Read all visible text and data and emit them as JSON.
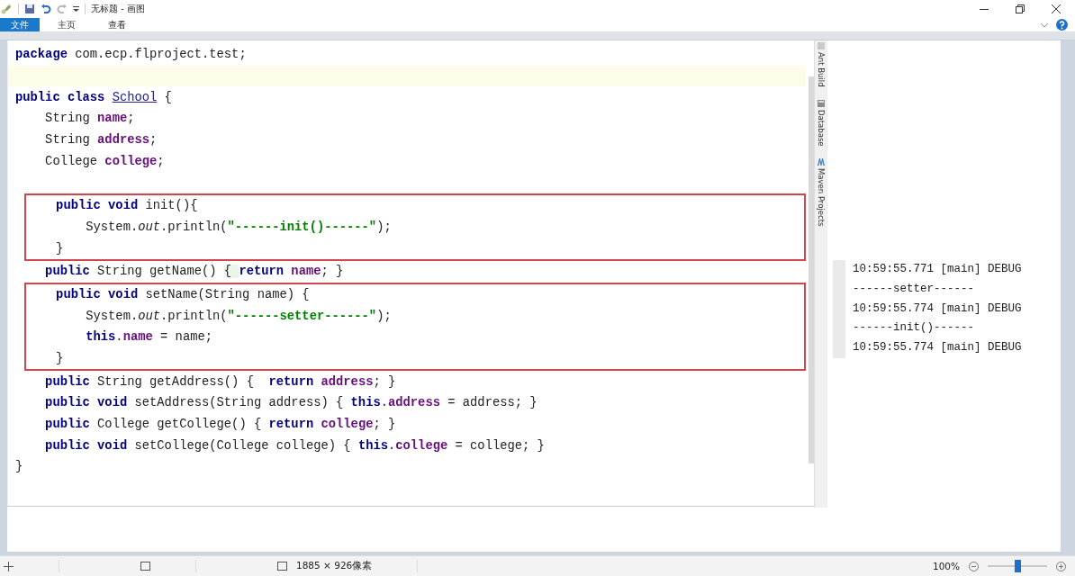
{
  "window": {
    "title": "无标题 - 画图"
  },
  "ribbon_tabs": [
    {
      "label": "文件",
      "selected": true
    },
    {
      "label": "主页",
      "selected": false
    },
    {
      "label": "查看",
      "selected": false
    }
  ],
  "code_blocks": [
    {
      "highlighted": false,
      "lines": [
        {
          "current": false,
          "tokens": [
            {
              "kind": "kw",
              "text": "package"
            },
            {
              "kind": "plain",
              "text": " com.ecp.flproject.test;"
            }
          ]
        },
        {
          "current": true
        },
        {
          "current": false,
          "tokens": [
            {
              "kind": "kw",
              "text": "public class "
            },
            {
              "kind": "link",
              "text": "School"
            },
            {
              "kind": "plain",
              "text": " {"
            }
          ]
        },
        {
          "current": false,
          "tokens": [
            {
              "kind": "plain",
              "text": "    String "
            },
            {
              "kind": "field",
              "text": "name"
            },
            {
              "kind": "plain",
              "text": ";"
            }
          ]
        },
        {
          "current": false,
          "tokens": [
            {
              "kind": "plain",
              "text": "    String "
            },
            {
              "kind": "field",
              "text": "address"
            },
            {
              "kind": "plain",
              "text": ";"
            }
          ]
        },
        {
          "current": false,
          "tokens": [
            {
              "kind": "plain",
              "text": "    College "
            },
            {
              "kind": "field",
              "text": "college"
            },
            {
              "kind": "plain",
              "text": ";"
            }
          ]
        },
        {
          "current": false
        }
      ]
    },
    {
      "highlighted": true,
      "lines": [
        {
          "current": false,
          "tokens": [
            {
              "kind": "kw",
              "text": "    public void"
            },
            {
              "kind": "plain",
              "text": " init(){"
            }
          ]
        },
        {
          "current": false,
          "tokens": [
            {
              "kind": "plain",
              "text": "        System."
            },
            {
              "kind": "italic",
              "text": "out"
            },
            {
              "kind": "plain",
              "text": ".println("
            },
            {
              "kind": "str",
              "text": "\"------init()------\""
            },
            {
              "kind": "plain",
              "text": ");"
            }
          ]
        },
        {
          "current": false,
          "tokens": [
            {
              "kind": "plain",
              "text": "    }"
            }
          ]
        }
      ]
    },
    {
      "highlighted": false,
      "lines": [
        {
          "current": false,
          "tokens": [
            {
              "kind": "kw",
              "text": "    public"
            },
            {
              "kind": "plain",
              "text": " String getName() "
            },
            {
              "kind": "fold",
              "text": "{ "
            },
            {
              "kind": "kw",
              "text": "return"
            },
            {
              "kind": "field",
              "text": " name"
            },
            {
              "kind": "plain",
              "text": "; }"
            }
          ]
        }
      ]
    },
    {
      "highlighted": true,
      "lines": [
        {
          "current": false,
          "tokens": [
            {
              "kind": "kw",
              "text": "    public void"
            },
            {
              "kind": "plain",
              "text": " setName(String name) {"
            }
          ]
        },
        {
          "current": false,
          "tokens": [
            {
              "kind": "plain",
              "text": "        System."
            },
            {
              "kind": "italic",
              "text": "out"
            },
            {
              "kind": "plain",
              "text": ".println("
            },
            {
              "kind": "str",
              "text": "\"------setter------\""
            },
            {
              "kind": "plain",
              "text": ");"
            }
          ]
        },
        {
          "current": false,
          "tokens": [
            {
              "kind": "kw",
              "text": "        this"
            },
            {
              "kind": "plain",
              "text": "."
            },
            {
              "kind": "field",
              "text": "name"
            },
            {
              "kind": "plain",
              "text": " = name;"
            }
          ]
        },
        {
          "current": false,
          "tokens": [
            {
              "kind": "plain",
              "text": "    }"
            }
          ]
        }
      ]
    },
    {
      "highlighted": false,
      "lines": [
        {
          "current": false,
          "tokens": [
            {
              "kind": "kw",
              "text": "    public"
            },
            {
              "kind": "plain",
              "text": " String getAddress() {  "
            },
            {
              "kind": "kw",
              "text": "return"
            },
            {
              "kind": "field",
              "text": " address"
            },
            {
              "kind": "plain",
              "text": "; }"
            }
          ]
        },
        {
          "current": false,
          "tokens": [
            {
              "kind": "kw",
              "text": "    public void"
            },
            {
              "kind": "plain",
              "text": " setAddress(String address) { "
            },
            {
              "kind": "kw",
              "text": "this"
            },
            {
              "kind": "plain",
              "text": "."
            },
            {
              "kind": "field",
              "text": "address"
            },
            {
              "kind": "plain",
              "text": " = address; }"
            }
          ]
        },
        {
          "current": false,
          "tokens": [
            {
              "kind": "kw",
              "text": "    public"
            },
            {
              "kind": "plain",
              "text": " College getCollege() { "
            },
            {
              "kind": "kw",
              "text": "return"
            },
            {
              "kind": "field",
              "text": " college"
            },
            {
              "kind": "plain",
              "text": "; }"
            }
          ]
        },
        {
          "current": false,
          "tokens": [
            {
              "kind": "kw",
              "text": "    public void"
            },
            {
              "kind": "plain",
              "text": " setCollege(College college) { "
            },
            {
              "kind": "kw",
              "text": "this"
            },
            {
              "kind": "plain",
              "text": "."
            },
            {
              "kind": "field",
              "text": "college"
            },
            {
              "kind": "plain",
              "text": " = college; }"
            }
          ]
        },
        {
          "current": false,
          "tokens": [
            {
              "kind": "plain",
              "text": "}"
            }
          ]
        }
      ]
    }
  ],
  "tool_tabs": [
    {
      "kind": "ant",
      "label": "Ant Build"
    },
    {
      "kind": "db",
      "label": "Database"
    },
    {
      "kind": "maven",
      "label": "Maven Projects"
    }
  ],
  "log_lines": [
    "10:59:55.771 [main] DEBUG",
    "------setter------",
    "10:59:55.774 [main] DEBUG",
    "------init()------",
    "10:59:55.774 [main] DEBUG"
  ],
  "status_bar": {
    "image_size": "1885 × 926像素",
    "zoom": "100%",
    "zoom_slider": {
      "level": 0.5
    }
  }
}
